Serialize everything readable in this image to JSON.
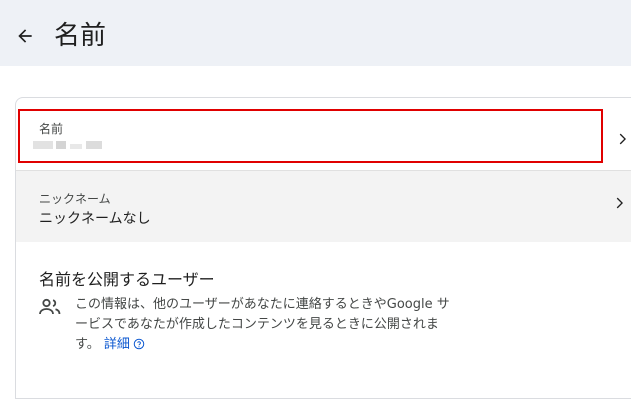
{
  "header": {
    "title": "名前",
    "back_icon": "arrow-back-icon"
  },
  "rows": [
    {
      "label": "名前",
      "value": "",
      "icon": "chevron-right-icon"
    },
    {
      "label": "ニックネーム",
      "value": "ニックネームなし",
      "icon": "chevron-right-icon"
    }
  ],
  "visibility": {
    "title": "名前を公開するユーザー",
    "icon": "people-icon",
    "text": "この情報は、他のユーザーがあなたに連絡するときやGoogle サービスであなたが作成したコンテンツを見るときに公開されます。",
    "learn_more": "詳細",
    "help_icon": "help-circle-icon"
  },
  "colors": {
    "header_bg": "#eef1f6",
    "highlight": "#e00000",
    "link": "#0b57d0"
  }
}
